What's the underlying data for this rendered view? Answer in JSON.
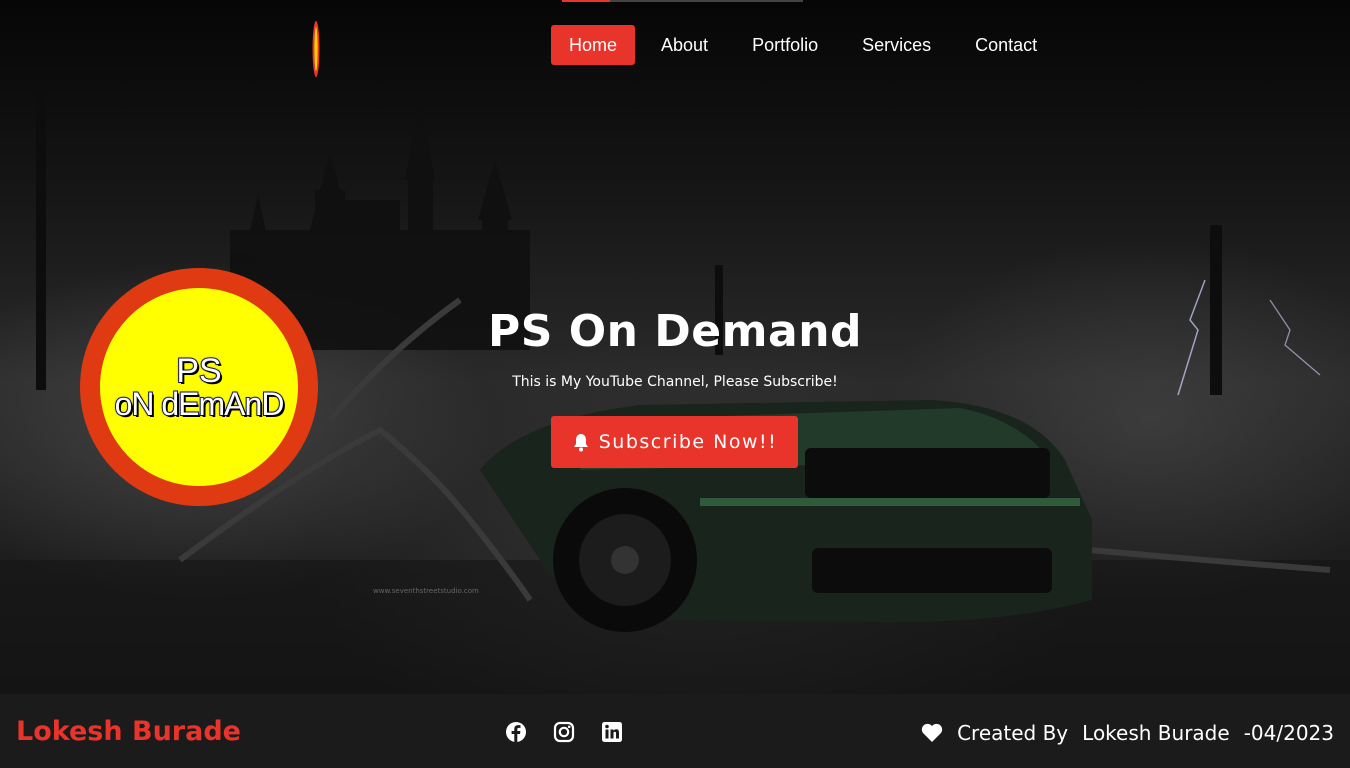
{
  "nav": {
    "items": [
      {
        "label": "Home",
        "active": true
      },
      {
        "label": "About",
        "active": false
      },
      {
        "label": "Portfolio",
        "active": false
      },
      {
        "label": "Services",
        "active": false
      },
      {
        "label": "Contact",
        "active": false
      }
    ]
  },
  "badge": {
    "line1": "PS",
    "line2": "oN dEmAnD"
  },
  "hero": {
    "title": "PS On Demand",
    "subtitle": "This is My YouTube Channel, Please Subscribe!",
    "cta_label": "Subscribe Now!!",
    "cta_icon": "bell-icon",
    "watermark": "www.seventhstreetstudio.com"
  },
  "footer": {
    "brand": "Lokesh Burade",
    "socials": [
      "facebook-icon",
      "instagram-icon",
      "linkedin-icon"
    ],
    "credit_icon": "heart-icon",
    "credit_prefix": "Created By",
    "credit_name": "Lokesh Burade",
    "credit_date": "-04/2023"
  },
  "colors": {
    "accent": "#e8342a",
    "badge_ring": "#e03a12",
    "badge_fill": "#ffff00",
    "footer_bg": "#1b1b1b"
  }
}
